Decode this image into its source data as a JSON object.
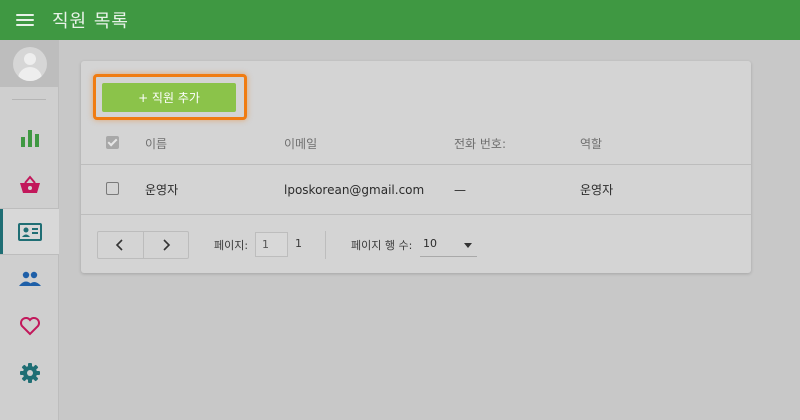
{
  "appbar": {
    "title": "직원 목록"
  },
  "sidebar": {
    "items": [
      {
        "name": "stats",
        "icon": "bar-chart-icon"
      },
      {
        "name": "shop",
        "icon": "basket-icon"
      },
      {
        "name": "employees",
        "icon": "id-card-icon",
        "active": true
      },
      {
        "name": "customers",
        "icon": "people-icon"
      },
      {
        "name": "favorites",
        "icon": "heart-icon"
      },
      {
        "name": "settings",
        "icon": "gear-icon"
      }
    ]
  },
  "toolbar": {
    "add_label": "+ 직원 추가"
  },
  "table": {
    "headers": {
      "name": "이름",
      "email": "이메일",
      "phone": "전화 번호:",
      "role": "역할"
    },
    "rows": [
      {
        "name": "운영자",
        "email": "lposkorean@gmail.com",
        "phone": "—",
        "role": "운영자"
      }
    ]
  },
  "pagination": {
    "page_label": "페이지:",
    "page_value": "1",
    "page_total": "1",
    "rows_label": "페이지 행 수:",
    "rows_value": "10"
  },
  "colors": {
    "appbar": "#3f9842",
    "accent": "#8bc34a",
    "highlight": "#f07c12",
    "active_indicator": "#1f6e74"
  }
}
